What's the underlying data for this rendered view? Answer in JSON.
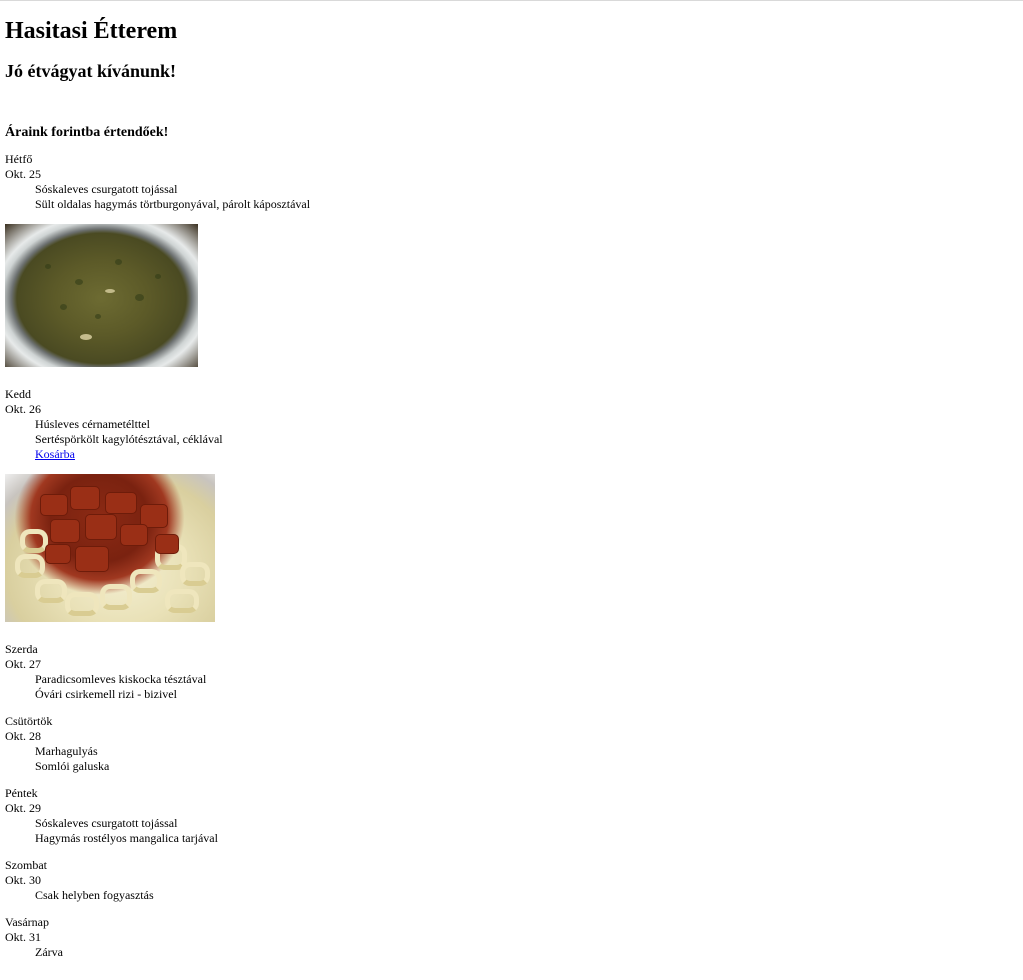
{
  "page": {
    "title": "Hasitasi Étterem",
    "subtitle": "Jó étvágyat kívánunk!",
    "price_note": "Áraink forintba értendőek!"
  },
  "days": [
    {
      "name": "Hétfő",
      "date": "Okt. 25",
      "dishes": [
        "Sóskaleves csurgatott tojással",
        "Sült oldalas hagymás törtburgonyával, párolt káposztával"
      ]
    },
    {
      "name": "Kedd",
      "date": "Okt. 26",
      "dishes": [
        "Húsleves cérnametélttel",
        "Sertéspörkölt kagylótésztával, céklával"
      ],
      "cart_link": "Kosárba"
    },
    {
      "name": "Szerda",
      "date": "Okt. 27",
      "dishes": [
        "Paradicsomleves kiskocka tésztával",
        "Óvári csirkemell rizi - bizivel"
      ]
    },
    {
      "name": "Csütörtök",
      "date": "Okt. 28",
      "dishes": [
        "Marhagulyás",
        "Somlói galuska"
      ]
    },
    {
      "name": "Péntek",
      "date": "Okt. 29",
      "dishes": [
        "Sóskaleves csurgatott tojással",
        "Hagymás rostélyos mangalica tarjával"
      ]
    },
    {
      "name": "Szombat",
      "date": "Okt. 30",
      "dishes": [
        "Csak helyben fogyasztás"
      ]
    },
    {
      "name": "Vasárnap",
      "date": "Okt. 31",
      "dishes": [
        "Zárva"
      ]
    }
  ],
  "images": {
    "monday_photo": "sorrel-soup-photo",
    "tuesday_photo": "pork-stew-pasta-photo"
  }
}
